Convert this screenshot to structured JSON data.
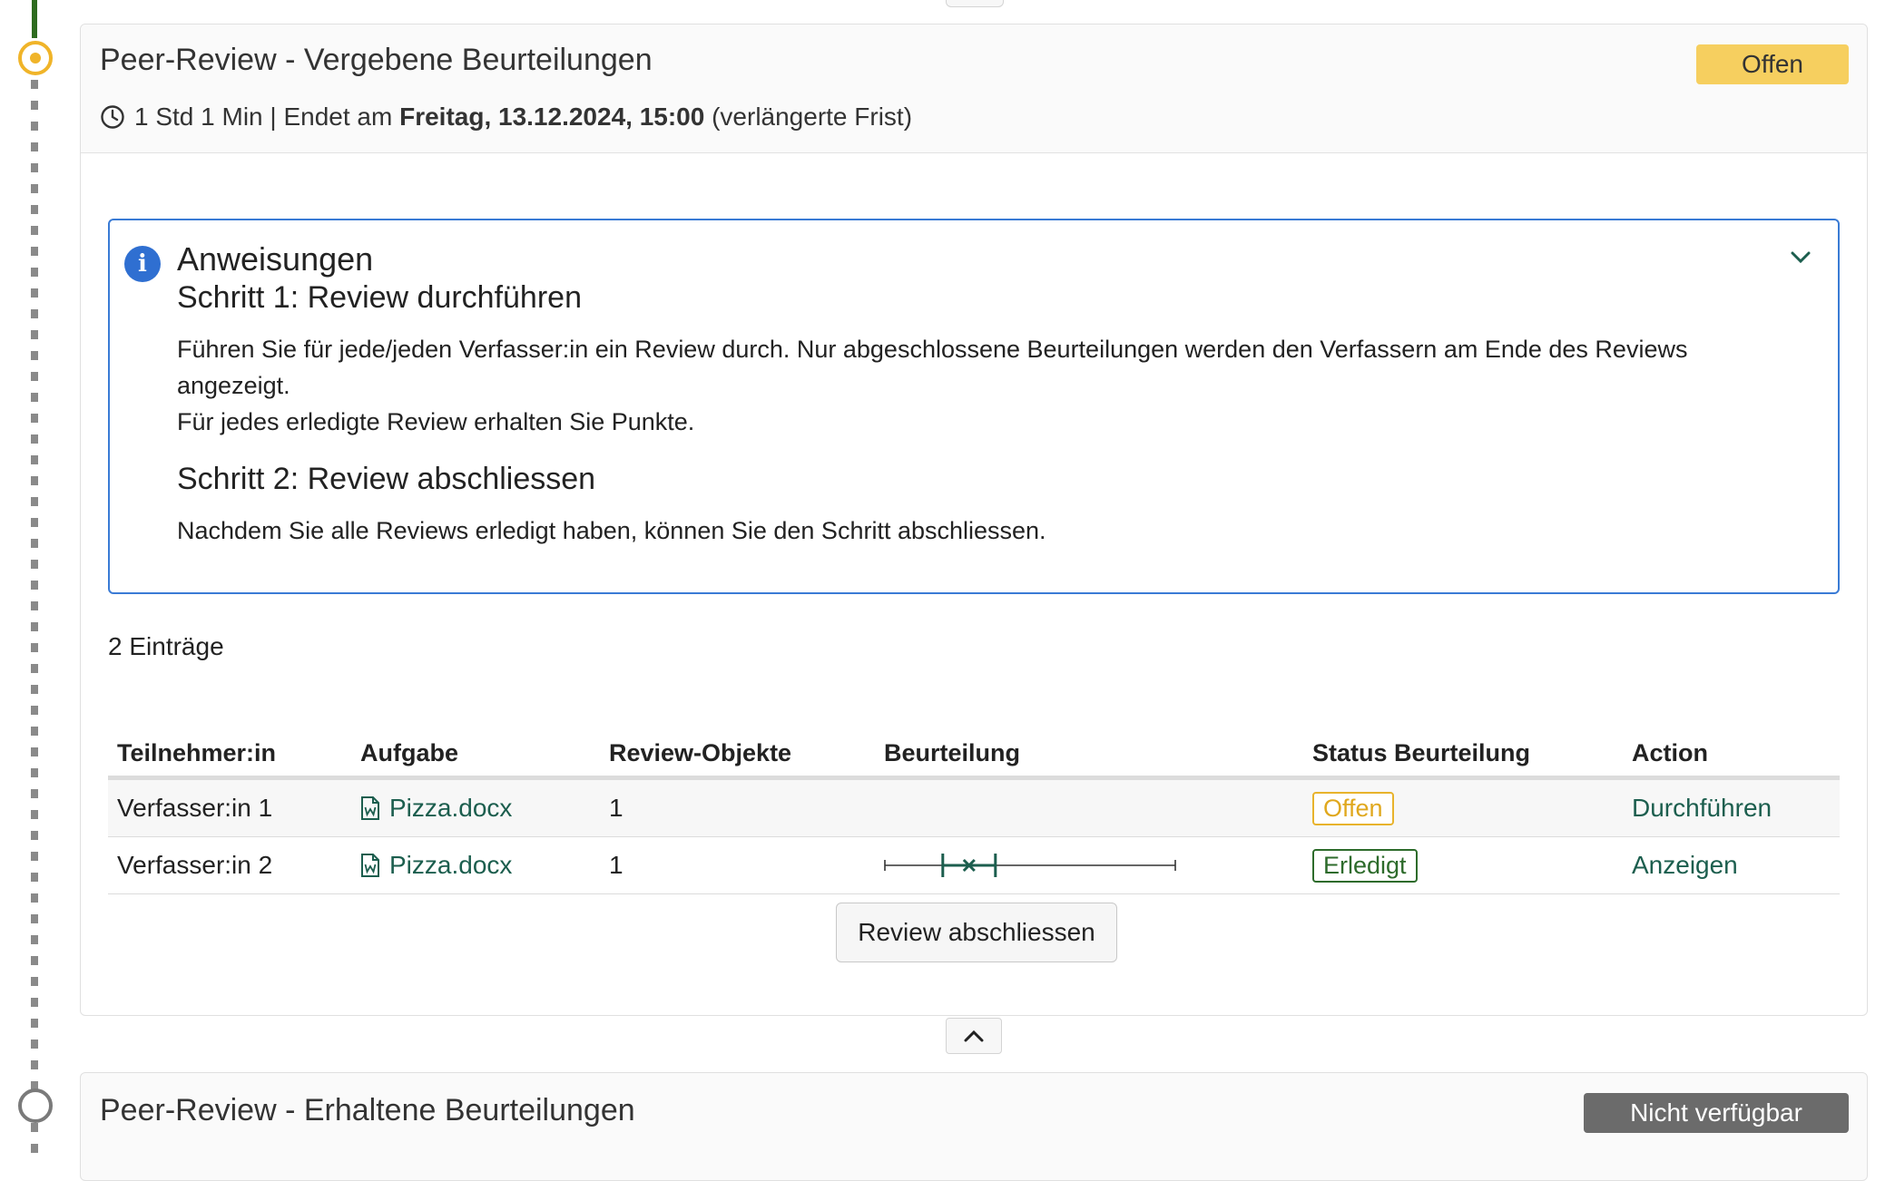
{
  "step1": {
    "title": "Peer-Review - Vergebene Beurteilungen",
    "badge": "Offen",
    "meta_duration": "1 Std 1 Min | Endet am",
    "meta_date": "Freitag, 13.12.2024, 15:00",
    "meta_note": "(verlängerte Frist)"
  },
  "instructions": {
    "title": "Anweisungen",
    "step1_title": "Schritt 1: Review durchführen",
    "step1_text1": "Führen Sie für jede/jeden Verfasser:in ein Review durch. Nur abgeschlossene Beurteilungen werden den Verfassern am Ende des Reviews angezeigt.",
    "step1_text2": "Für jedes erledigte Review erhalten Sie Punkte.",
    "step2_title": "Schritt 2: Review abschliessen",
    "step2_text": "Nachdem Sie alle Reviews erledigt haben, können Sie den Schritt abschliessen."
  },
  "entries_label": "2 Einträge",
  "table": {
    "headers": [
      "Teilnehmer:in",
      "Aufgabe",
      "Review-Objekte",
      "Beurteilung",
      "Status Beurteilung",
      "Action"
    ],
    "rows": [
      {
        "participant": "Verfasser:in 1",
        "task": "Pizza.docx",
        "objects": "1",
        "rating": null,
        "status": "Offen",
        "action": "Durchführen"
      },
      {
        "participant": "Verfasser:in 2",
        "task": "Pizza.docx",
        "objects": "1",
        "rating": 0.29,
        "status": "Erledigt",
        "action": "Anzeigen"
      }
    ]
  },
  "review_button": "Review abschliessen",
  "step2": {
    "title": "Peer-Review - Erhaltene Beurteilungen",
    "badge": "Nicht verfügbar"
  },
  "colors": {
    "accent": "#1c5e4e",
    "badge_open": "#f6cf5f",
    "badge_unavailable": "#6b6b6b",
    "info_border": "#3a7bd5"
  },
  "icons": [
    "clock-icon",
    "info-icon",
    "chevron-down-icon",
    "word-file-icon",
    "chevron-up-icon"
  ]
}
